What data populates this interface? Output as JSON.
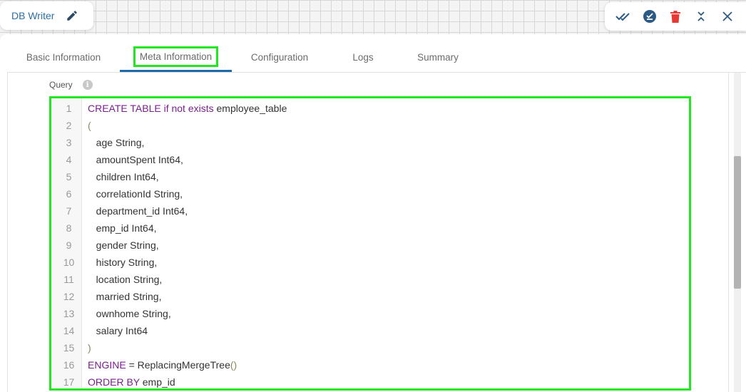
{
  "header": {
    "title": "DB Writer",
    "colors": {
      "accent": "#1f6aa8",
      "highlight": "#22e622",
      "delete": "#e53935"
    }
  },
  "actions": [
    {
      "icon": "double-check-icon"
    },
    {
      "icon": "check-circle-icon"
    },
    {
      "icon": "trash-icon"
    },
    {
      "icon": "collapse-icon"
    },
    {
      "icon": "close-icon"
    }
  ],
  "tabs": [
    {
      "label": "Basic Information"
    },
    {
      "label": "Meta Information",
      "active": true
    },
    {
      "label": "Configuration"
    },
    {
      "label": "Logs"
    },
    {
      "label": "Summary"
    }
  ],
  "query": {
    "label": "Query",
    "info": "i"
  },
  "code": [
    [
      {
        "t": "CREATE TABLE if not exists",
        "c": "kw"
      },
      {
        "t": " employee_table"
      }
    ],
    [
      {
        "t": "(",
        "c": "br"
      }
    ],
    [
      {
        "t": "   age String,"
      }
    ],
    [
      {
        "t": "   amountSpent Int64,"
      }
    ],
    [
      {
        "t": "   children Int64,"
      }
    ],
    [
      {
        "t": "   correlationId String,"
      }
    ],
    [
      {
        "t": "   department_id Int64,"
      }
    ],
    [
      {
        "t": "   emp_id Int64,"
      }
    ],
    [
      {
        "t": "   gender String,"
      }
    ],
    [
      {
        "t": "   history String,"
      }
    ],
    [
      {
        "t": "   location String,"
      }
    ],
    [
      {
        "t": "   married String,"
      }
    ],
    [
      {
        "t": "   ownhome String,"
      }
    ],
    [
      {
        "t": "   salary Int64"
      }
    ],
    [
      {
        "t": ")",
        "c": "br"
      }
    ],
    [
      {
        "t": "ENGINE",
        "c": "kw"
      },
      {
        "t": " = ReplacingMergeTree"
      },
      {
        "t": "()",
        "c": "br"
      }
    ],
    [
      {
        "t": "ORDER BY",
        "c": "kw"
      },
      {
        "t": " emp_id"
      }
    ]
  ]
}
